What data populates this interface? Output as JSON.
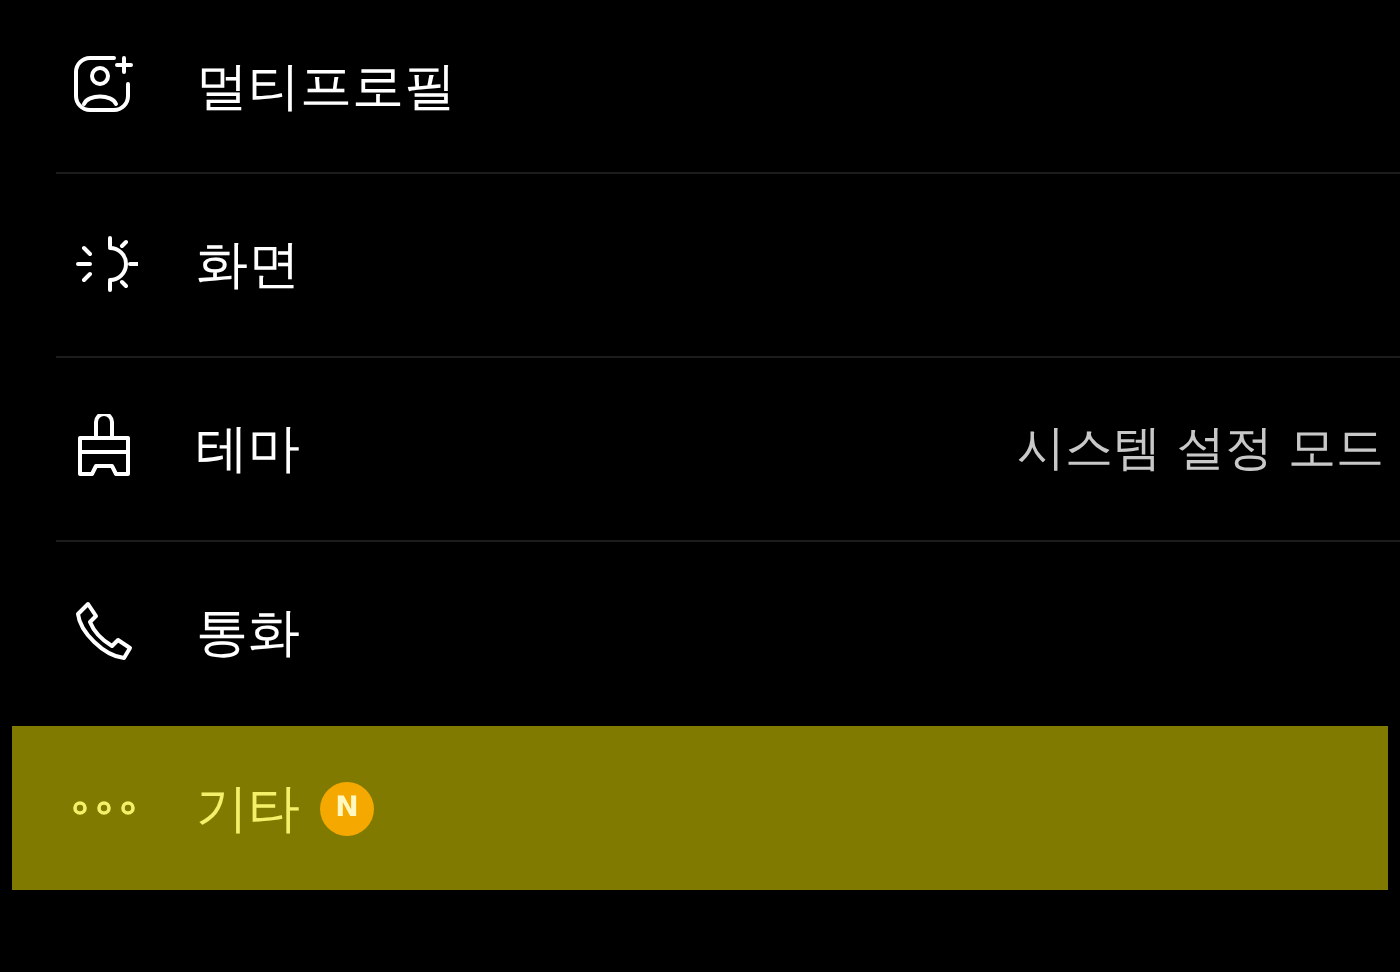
{
  "menu": [
    {
      "kind": "profile",
      "label": "멀티프로필",
      "selected": false
    },
    {
      "kind": "brightness",
      "label": "화면",
      "selected": false
    },
    {
      "kind": "theme",
      "label": "테마",
      "value": "시스템 설정 모드",
      "selected": false
    },
    {
      "kind": "phone",
      "label": "통화",
      "selected": false
    },
    {
      "kind": "more",
      "label": "기타",
      "badge": "N",
      "selected": true
    }
  ]
}
